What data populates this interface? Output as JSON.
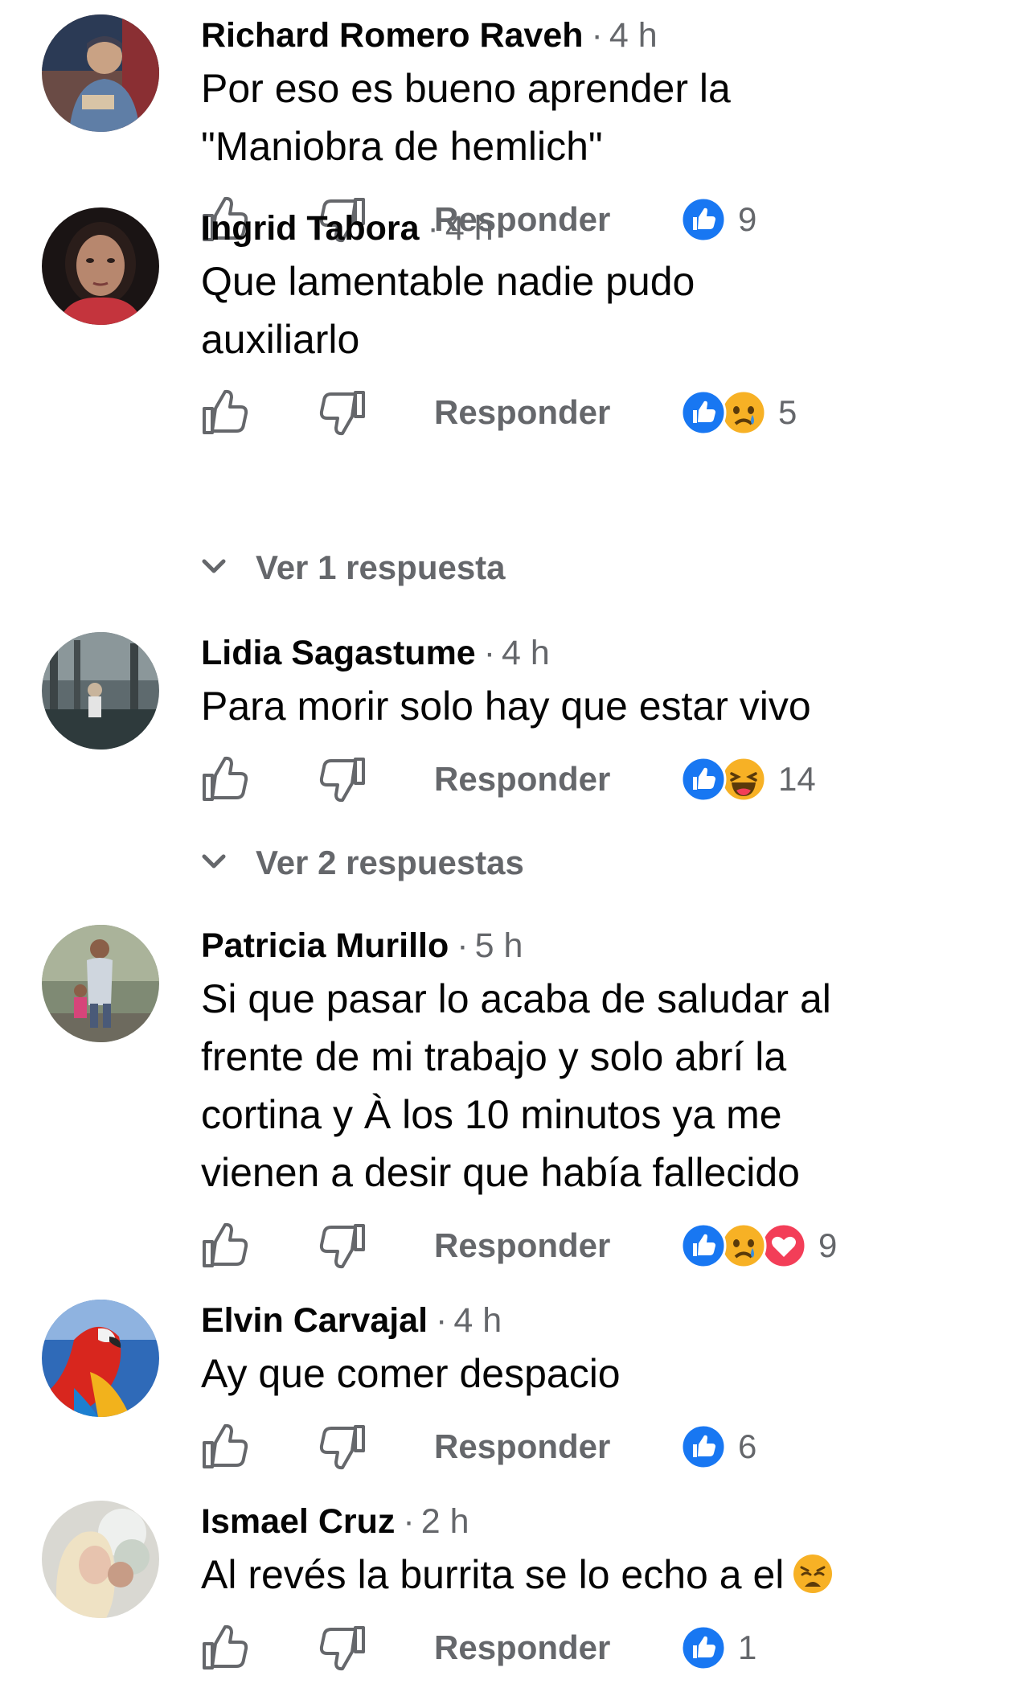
{
  "comments": [
    {
      "author": "Richard Romero Raveh",
      "time": "4 h",
      "text": [
        "Por eso es bueno aprender la",
        "\"Maniobra de hemlich\""
      ],
      "reply_label": "Responder",
      "reactions": [
        "like"
      ],
      "reaction_count": "9"
    },
    {
      "author": "Ingrid Tabora",
      "time": "4 h",
      "text": [
        "Que lamentable nadie pudo",
        "auxiliarlo"
      ],
      "reply_label": "Responder",
      "reactions": [
        "like",
        "sad"
      ],
      "reaction_count": "5",
      "replies_label": "Ver 1 respuesta"
    },
    {
      "author": "Lidia Sagastume",
      "time": "4 h",
      "text": [
        "Para morir solo hay que estar vivo"
      ],
      "reply_label": "Responder",
      "reactions": [
        "like",
        "haha"
      ],
      "reaction_count": "14",
      "replies_label": "Ver 2 respuestas"
    },
    {
      "author": "Patricia Murillo",
      "time": "5 h",
      "text": [
        "Si que pasar lo acaba de saludar al",
        "frente de mi trabajo y solo abrí la",
        "cortina y À los 10 minutos ya me",
        "vienen a desir que había fallecido"
      ],
      "reply_label": "Responder",
      "reactions": [
        "like",
        "sad",
        "love"
      ],
      "reaction_count": "9"
    },
    {
      "author": "Elvin Carvajal",
      "time": "4 h",
      "text": [
        "Ay que comer despacio"
      ],
      "reply_label": "Responder",
      "reactions": [
        "like"
      ],
      "reaction_count": "6"
    },
    {
      "author": "Ismael Cruz",
      "time": "2 h",
      "text": [
        "Al revés la burrita se lo echo a el"
      ],
      "text_emoji": "weary-face",
      "reply_label": "Responder",
      "reactions": [
        "like"
      ],
      "reaction_count": "1"
    }
  ],
  "colors": {
    "like_blue": "#1877f2",
    "love_red": "#f33e58",
    "emoji_yellow": "#f7b125",
    "secondary_text": "#65676b",
    "primary_text": "#050505"
  }
}
